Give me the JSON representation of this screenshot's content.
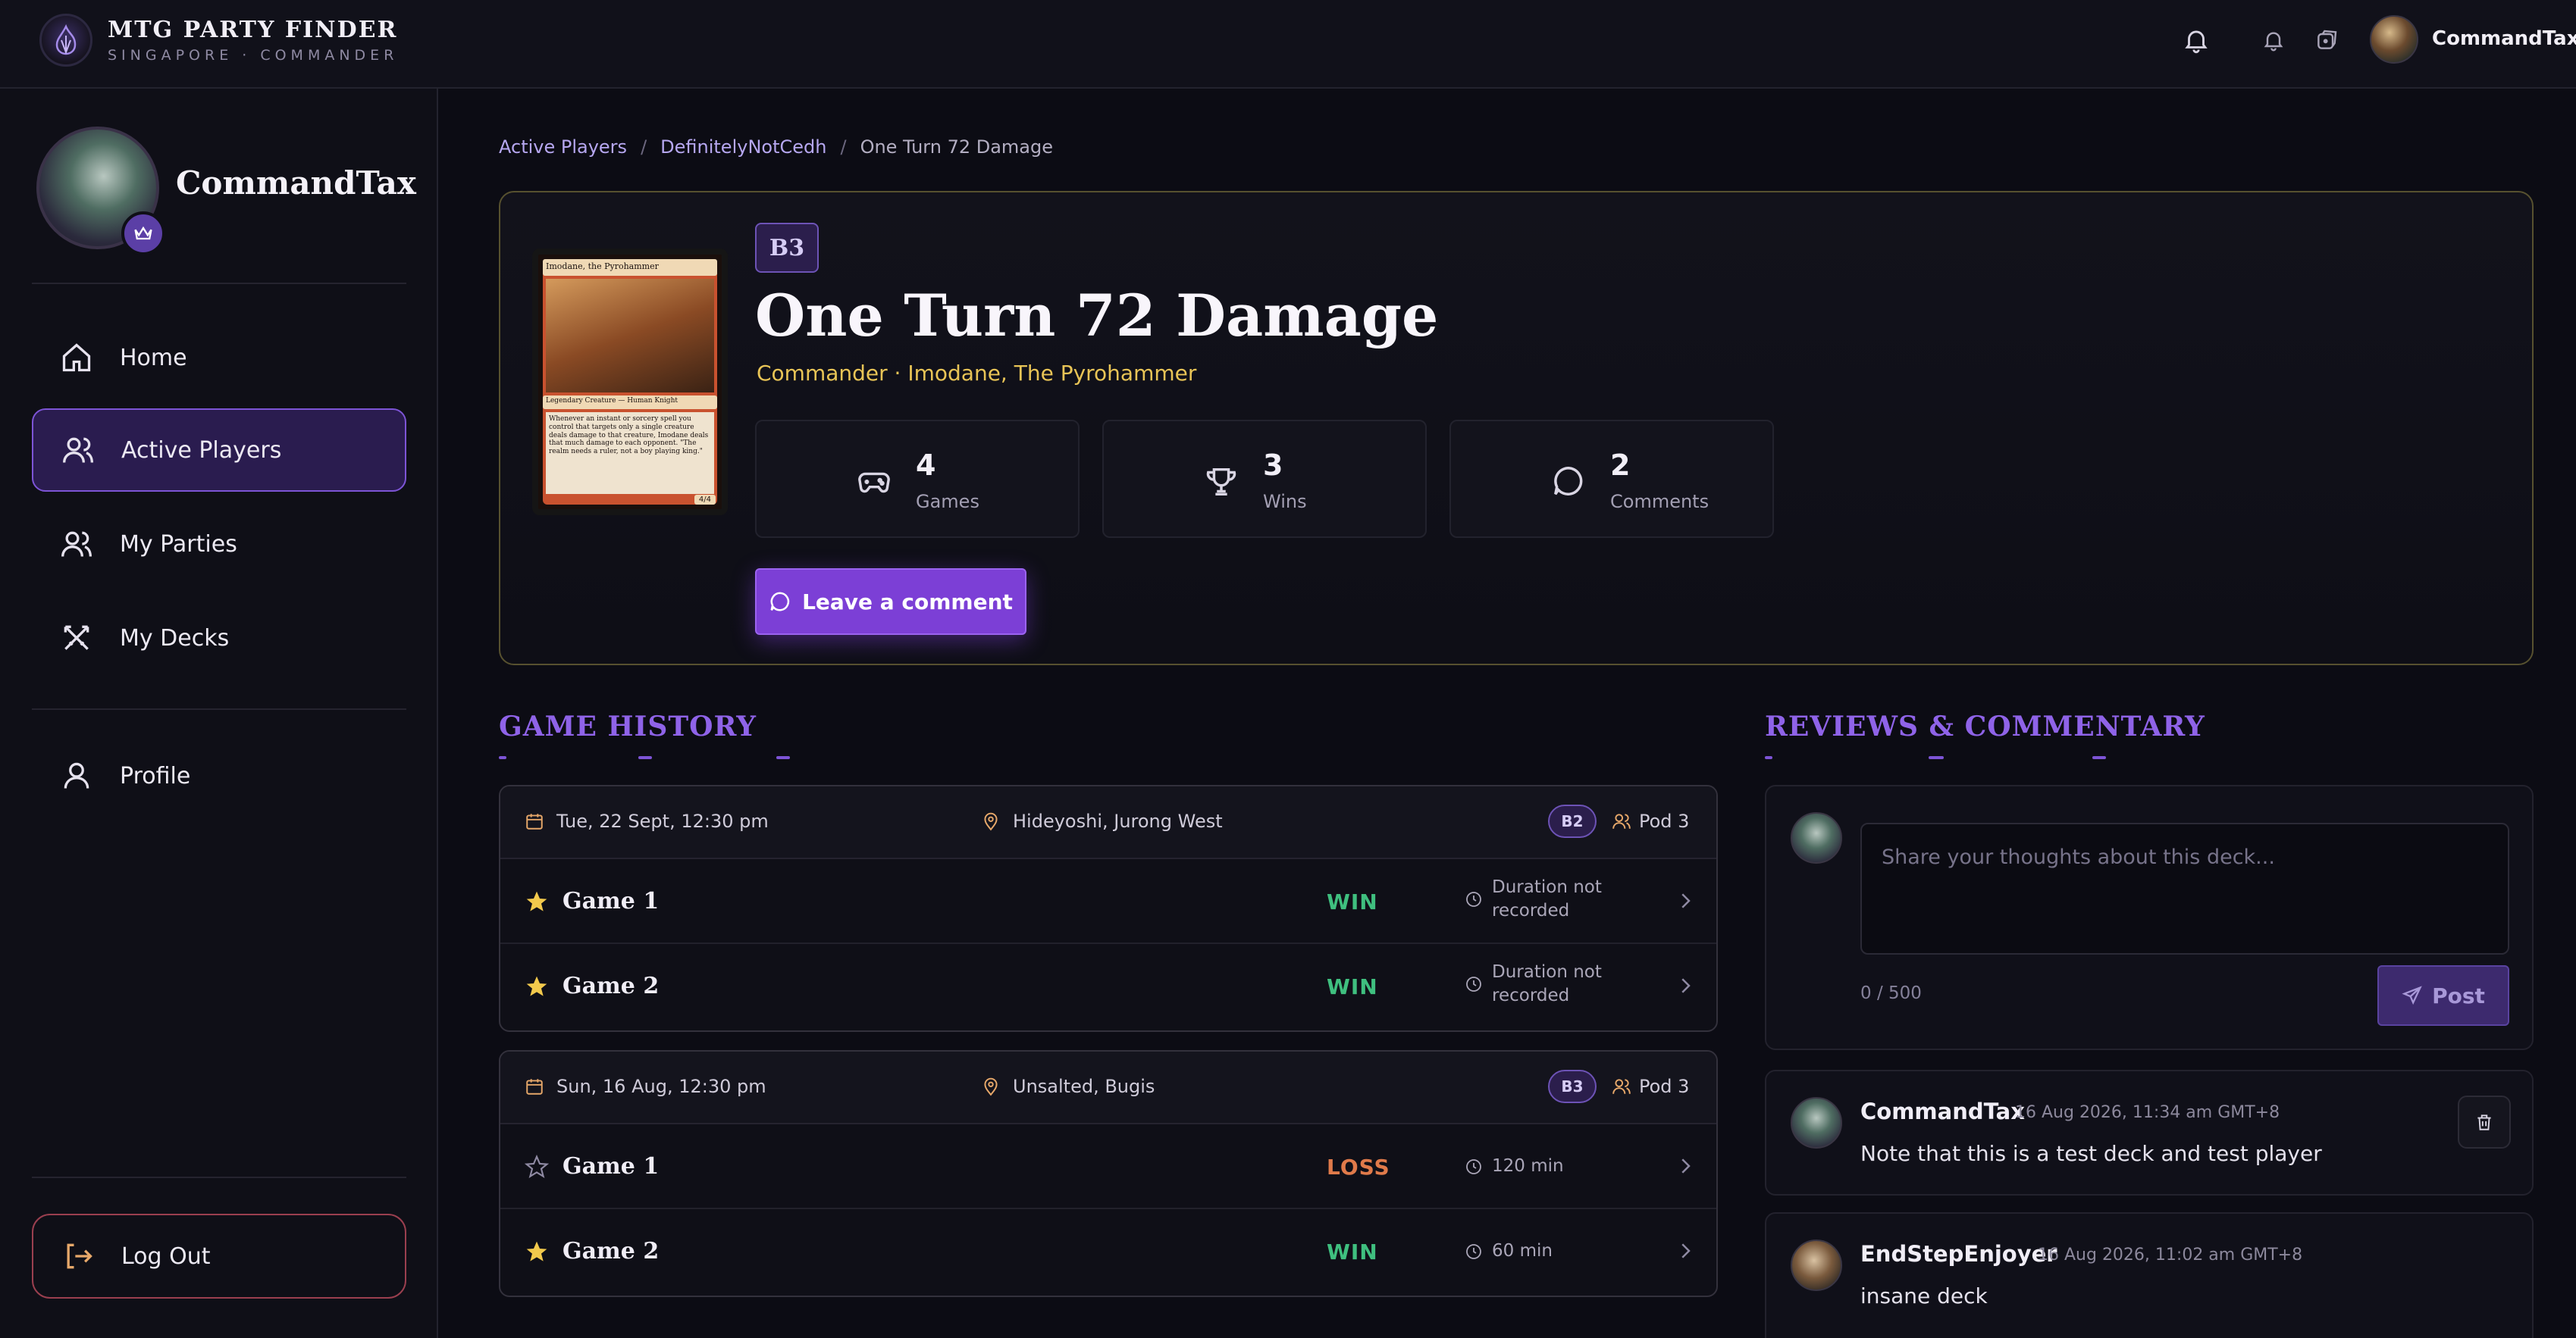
{
  "brand": {
    "title": "MTG PARTY FINDER",
    "subtitle": "SINGAPORE · COMMANDER"
  },
  "topbar": {
    "username": "CommandTax",
    "icons": [
      "bell-icon",
      "bell-small-icon",
      "dice-icon"
    ]
  },
  "sidebar": {
    "username": "CommandTax",
    "nav": [
      {
        "label": "Home",
        "icon": "home-icon",
        "active": false
      },
      {
        "label": "Active Players",
        "icon": "users-icon",
        "active": true
      },
      {
        "label": "My Parties",
        "icon": "users-icon",
        "active": false
      },
      {
        "label": "My Decks",
        "icon": "swords-icon",
        "active": false
      },
      {
        "label": "Profile",
        "icon": "user-icon",
        "active": false
      }
    ],
    "logout": "Log Out"
  },
  "breadcrumb": [
    "Active Players",
    "DefinitelyNotCedh",
    "One Turn 72 Damage"
  ],
  "deck": {
    "bracket": "B3",
    "title": "One Turn 72 Damage",
    "subtitle": "Commander · Imodane, The Pyrohammer",
    "card": {
      "name": "Imodane, the Pyrohammer",
      "type": "Legendary Creature — Human Knight",
      "text": "Whenever an instant or sorcery spell you control that targets only a single creature deals damage to that creature, Imodane deals that much damage to each opponent. \"The realm needs a ruler, not a boy playing king.\"",
      "pt": "4/4"
    },
    "stats": [
      {
        "value": "4",
        "label": "Games",
        "icon": "gamepad-icon"
      },
      {
        "value": "3",
        "label": "Wins",
        "icon": "trophy-icon"
      },
      {
        "value": "2",
        "label": "Comments",
        "icon": "chat-icon"
      }
    ],
    "leave_comment": "Leave a comment"
  },
  "game_history": {
    "title": "GAME HISTORY",
    "sessions": [
      {
        "date": "Tue, 22 Sept, 12:30 pm",
        "location": "Hideyoshi, Jurong West",
        "bracket": "B2",
        "pod": "Pod 3",
        "games": [
          {
            "name": "Game 1",
            "result": "WIN",
            "duration_line1": "Duration not",
            "duration_line2": "recorded",
            "starred": true
          },
          {
            "name": "Game 2",
            "result": "WIN",
            "duration_line1": "Duration not",
            "duration_line2": "recorded",
            "starred": true
          }
        ]
      },
      {
        "date": "Sun, 16 Aug, 12:30 pm",
        "location": "Unsalted, Bugis",
        "bracket": "B3",
        "pod": "Pod 3",
        "games": [
          {
            "name": "Game 1",
            "result": "LOSS",
            "duration_line1": "120 min",
            "duration_line2": "",
            "starred": false
          },
          {
            "name": "Game 2",
            "result": "WIN",
            "duration_line1": "60 min",
            "duration_line2": "",
            "starred": true
          }
        ]
      }
    ]
  },
  "reviews": {
    "title": "REVIEWS & COMMENTARY",
    "placeholder": "Share your thoughts about this deck...",
    "counter": "0 / 500",
    "post_label": "Post",
    "comments": [
      {
        "author": "CommandTax",
        "time": "16 Aug 2026, 11:34 am GMT+8",
        "body": "Note that this is a test deck and test player"
      },
      {
        "author": "EndStepEnjoyer",
        "time": "16 Aug 2026, 11:02 am GMT+8",
        "body": "insane deck"
      }
    ]
  },
  "colors": {
    "accent": "#7c3fd6",
    "gold": "#e8c456",
    "win": "#3fbf7f",
    "loss": "#e07a4a"
  }
}
